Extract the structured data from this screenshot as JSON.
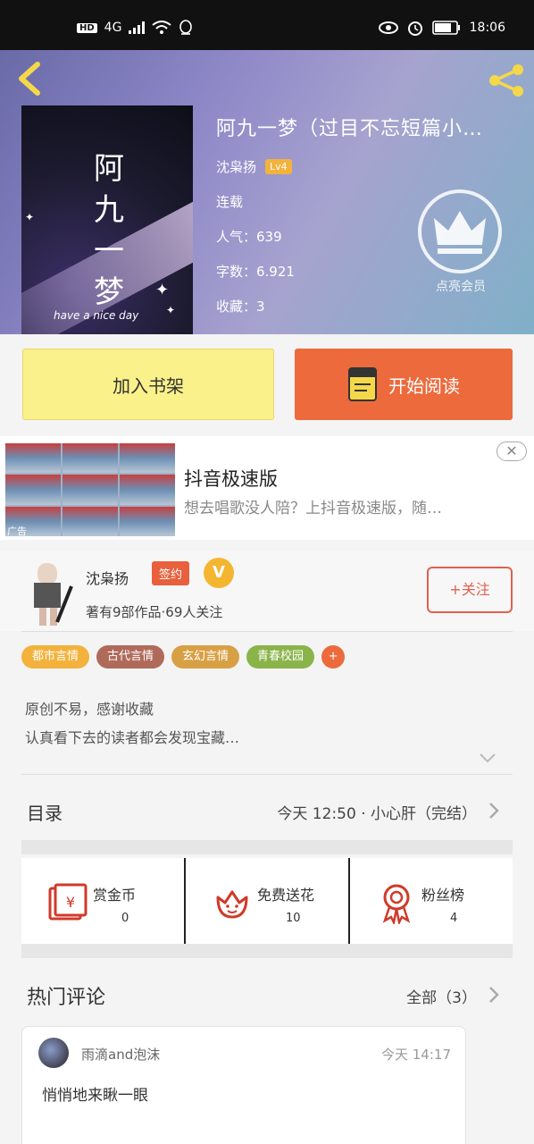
{
  "status": {
    "network": "4G",
    "time": "18:06",
    "hd": "HD"
  },
  "book": {
    "title": "阿九一梦（过目不忘短篇小…",
    "author": "沈枭扬",
    "level": "Lv4",
    "status": "连载",
    "popularity": "人气：639",
    "word_count": "字数：6.921",
    "favorites": "收藏：3",
    "cover_title": "阿九一梦",
    "cover_subtitle": "have a nice day",
    "rank_label": "点亮会员"
  },
  "actions": {
    "add_shelf": "加入书架",
    "start_reading": "开始阅读"
  },
  "ad": {
    "title": "抖音极速版",
    "desc": "想去唱歌没人陪？上抖音极速版，随…",
    "tag": "广告",
    "close": "✕"
  },
  "author": {
    "name": "沈枭扬",
    "badge": "签约",
    "vip": "V",
    "stats": "著有9部作品·69人关注",
    "follow_label": "+关注"
  },
  "tags": [
    {
      "label": "都市言情",
      "color": "#f3b23c"
    },
    {
      "label": "古代言情",
      "color": "#b06a5a"
    },
    {
      "label": "玄幻言情",
      "color": "#d8a044"
    },
    {
      "label": "青春校园",
      "color": "#8ab44a"
    },
    {
      "label": "+",
      "color": "#ec6a3c"
    }
  ],
  "description": {
    "line1": "原创不易，感谢收藏",
    "line2": "认真看下去的读者都会发现宝藏…"
  },
  "catalog": {
    "label": "目录",
    "update": "今天 12:50 · 小心肝（完结）"
  },
  "gifts": [
    {
      "label": "赏金币",
      "count": "0",
      "icon": "red-envelope-icon"
    },
    {
      "label": "免费送花",
      "count": "10",
      "icon": "flower-icon"
    },
    {
      "label": "粉丝榜",
      "count": "4",
      "icon": "medal-icon"
    }
  ],
  "comments_section": {
    "title": "热门评论",
    "all_label": "全部（3）"
  },
  "comments": [
    {
      "user": "雨滴and泡沫",
      "time": "今天 14:17",
      "text": "悄悄地来瞅一眼"
    }
  ],
  "colors": {
    "accent": "#ec6a3c",
    "shelf": "#fbf18a",
    "lv": "#f3b23c"
  }
}
